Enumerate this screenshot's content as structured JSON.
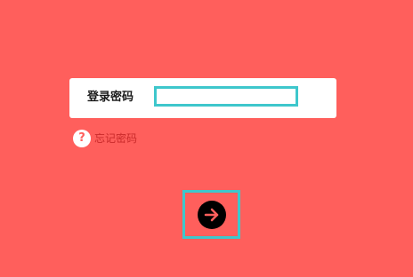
{
  "colors": {
    "background": "#ff5f5c",
    "card": "#ffffff",
    "focus_border": "#3ec7cc",
    "link": "#c92a2a",
    "submit_button": "#000000",
    "submit_arrow": "#ff5f5c"
  },
  "login": {
    "password_label": "登录密码",
    "password_value": "",
    "forgot_password": "忘记密码",
    "help_icon": "question-circle-icon",
    "submit_icon": "arrow-right-icon"
  }
}
